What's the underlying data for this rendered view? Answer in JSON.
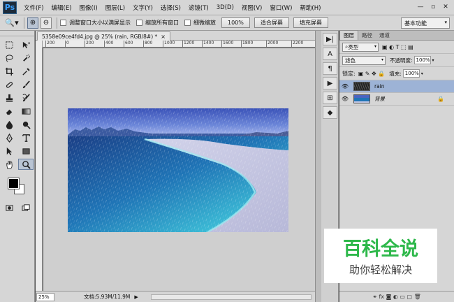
{
  "app": {
    "logo": "Ps"
  },
  "menu": [
    "文件(F)",
    "编辑(E)",
    "图像(I)",
    "图层(L)",
    "文字(Y)",
    "选择(S)",
    "滤镜(T)",
    "3D(D)",
    "视图(V)",
    "窗口(W)",
    "帮助(H)"
  ],
  "window_controls": [
    "—",
    "▫",
    "✕"
  ],
  "options_bar": {
    "tool_icon": "zoom-icon",
    "checkbox_resize": "调整窗口大小以满屏显示",
    "checkbox_zoom_all": "缩放所有窗口",
    "checkbox_scrubby": "细微缩放",
    "btn_100": "100%",
    "btn_fit": "适合屏幕",
    "btn_fill": "填充屏幕",
    "workspace": "基本功能"
  },
  "document": {
    "tab_title": "5358e09ce4fd4.jpg @ 25% (rain, RGB/8#) *",
    "close": "×",
    "ruler_ticks": [
      "200",
      "0",
      "200",
      "400",
      "600",
      "800",
      "1000",
      "1200",
      "1400",
      "1600",
      "1800",
      "2000",
      "2200"
    ]
  },
  "status": {
    "zoom": "25%",
    "doc_size": "文档:5.93M/11.9M",
    "arrow": "▶"
  },
  "mini_panel": [
    "▶|",
    "A",
    "¶",
    "▶",
    "⊞",
    "◆"
  ],
  "layers_panel": {
    "tabs": [
      "图层",
      "路径",
      "通道"
    ],
    "filter_type": "类型",
    "filter_icons": "▣ ◐ T ⬚ ▤",
    "blend_mode": "滤色",
    "opacity_label": "不透明度:",
    "opacity_value": "100%",
    "lock_label": "锁定:",
    "lock_icons": "▣ ✎ ✥ 🔒",
    "fill_label": "填充:",
    "fill_value": "100%",
    "layers": [
      {
        "name": "rain",
        "selected": true,
        "eye": "👁"
      },
      {
        "name": "背景",
        "selected": false,
        "eye": "👁",
        "lock": "🔒"
      }
    ],
    "bottom_icons": "⚭ fx ◙ ◐ ▭ ▢ 🗑"
  },
  "watermark": {
    "title": "百科全说",
    "subtitle": "助你轻松解决",
    "title_color": "#2db84a",
    "subtitle_color": "#444444"
  }
}
